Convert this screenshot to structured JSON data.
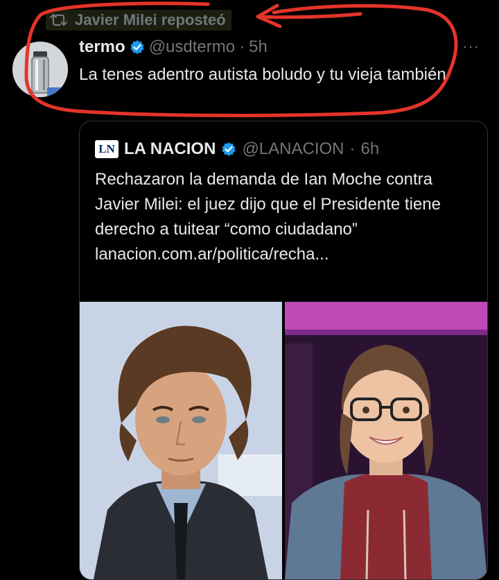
{
  "repost": {
    "text": "Javier Milei reposteó"
  },
  "tweet": {
    "name": "termo",
    "handle": "@usdtermo",
    "separator": "·",
    "time": "5h",
    "text": "La tenes adentro autista boludo y tu vieja también",
    "more": "···"
  },
  "quote": {
    "logo": "LN",
    "name": "LA NACION",
    "handle": "@LANACION",
    "separator": "·",
    "time": "6h",
    "text": "Rechazaron la demanda de Ian Moche contra Javier Milei: el juez dijo que el Presidente tiene derecho a tuitear “como ciudadano” lanacion.com.ar/politica/recha..."
  },
  "colors": {
    "background": "#000000",
    "text_primary": "#e7e9ea",
    "text_secondary": "#71767b",
    "verified": "#1d9bf0",
    "annotation": "#e5342b",
    "border": "#2f3336"
  },
  "icons": {
    "repost": "repost-icon",
    "verified": "verified-badge-icon",
    "more": "more-icon"
  }
}
